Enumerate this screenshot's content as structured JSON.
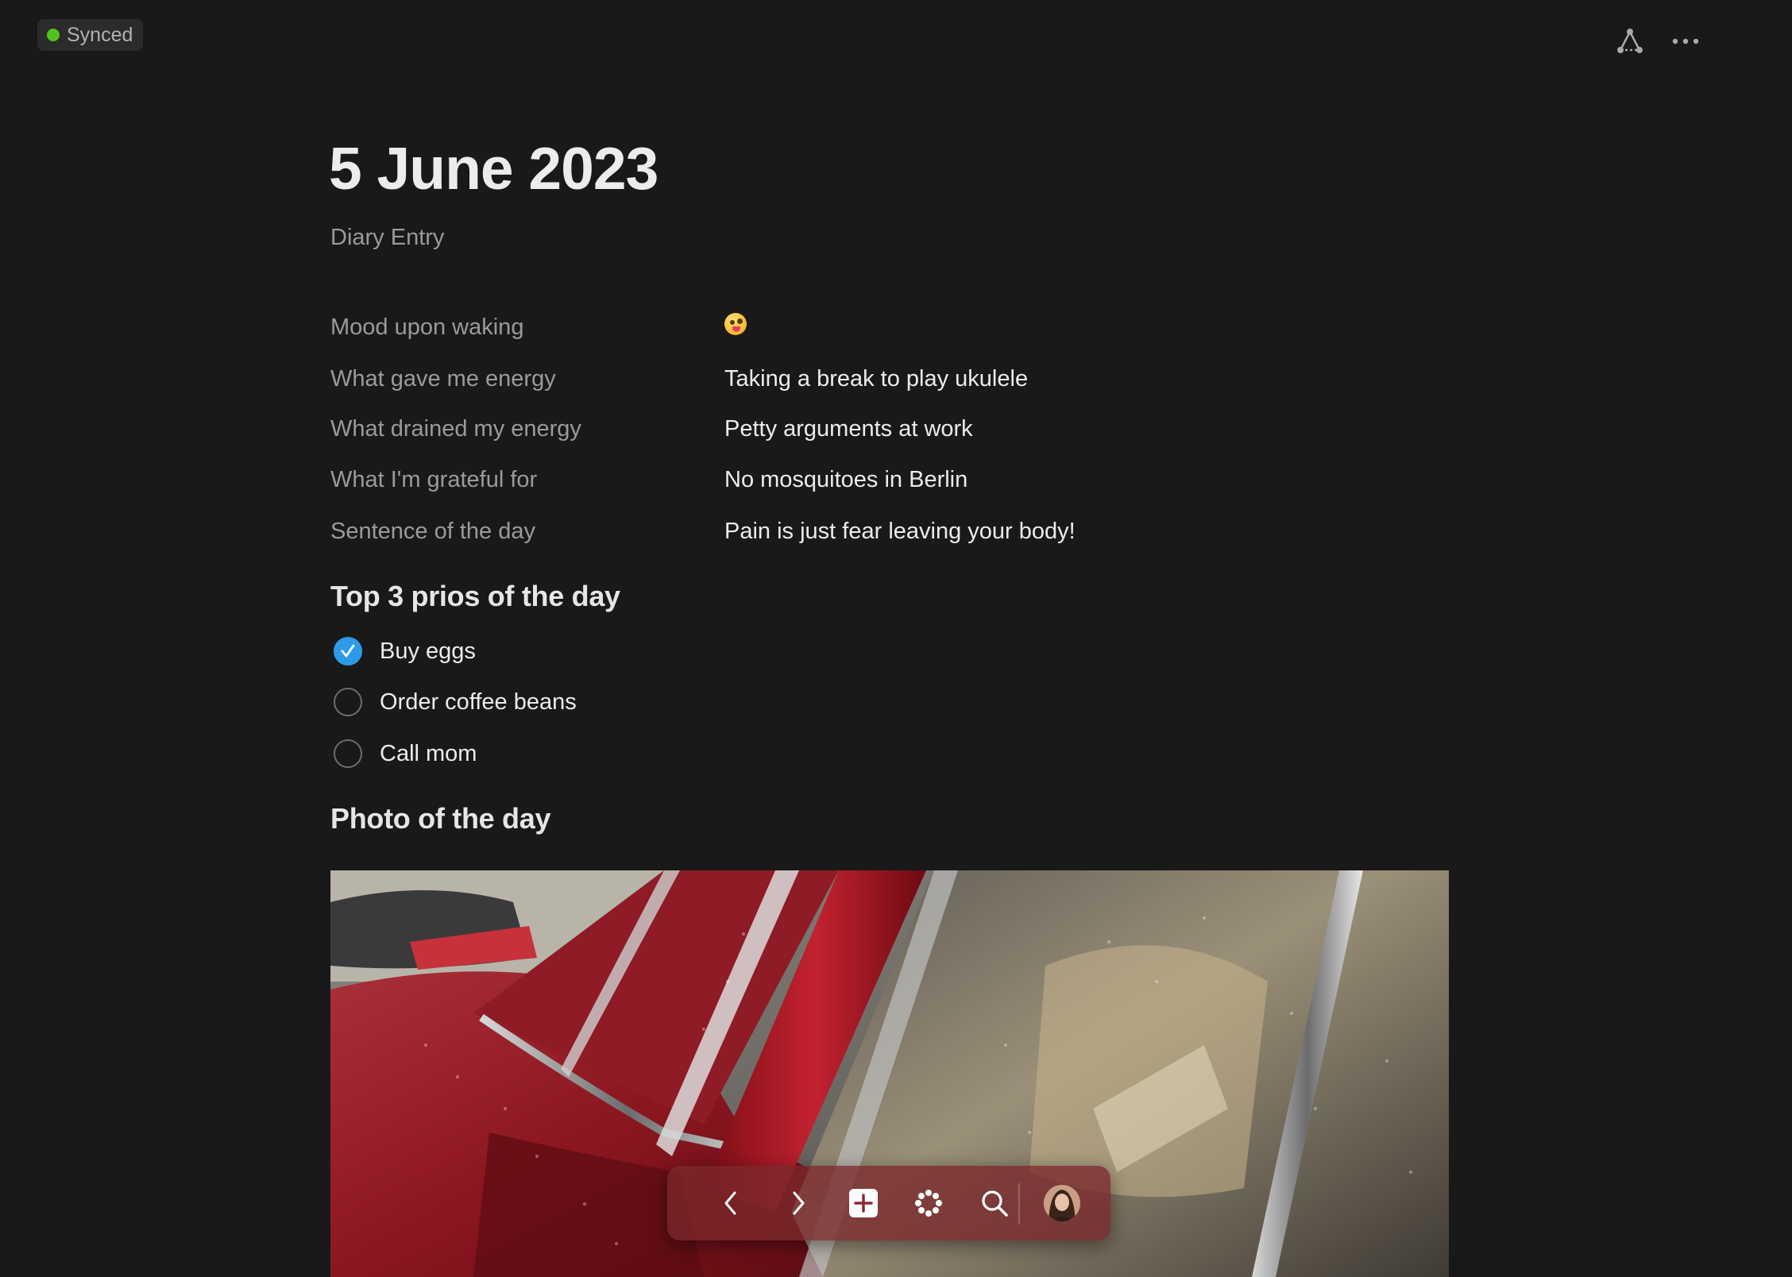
{
  "status": {
    "label": "Synced",
    "color": "#4fc41b"
  },
  "top_actions": {
    "graph_icon": "graph-icon",
    "more_icon": "more-horizontal-icon"
  },
  "page": {
    "title": "5 June 2023",
    "subtitle": "Diary Entry"
  },
  "properties": [
    {
      "label": "Mood upon waking",
      "value": "",
      "emoji": "zany-face-emoji"
    },
    {
      "label": "What gave me energy",
      "value": "Taking a break to play ukulele"
    },
    {
      "label": "What drained my energy",
      "value": "Petty arguments at work"
    },
    {
      "label": "What I'm grateful for",
      "value": "No mosquitoes in Berlin"
    },
    {
      "label": "Sentence of the day",
      "value": "Pain is just fear leaving your body!"
    }
  ],
  "priorities": {
    "heading": "Top 3 prios of the day",
    "items": [
      {
        "label": "Buy eggs",
        "checked": true
      },
      {
        "label": "Order coffee beans",
        "checked": false
      },
      {
        "label": "Call mom",
        "checked": false
      }
    ]
  },
  "photo_section": {
    "heading": "Photo of the day",
    "image": "red-vintage-car-with-raindrops-photo"
  },
  "toolbar": {
    "back_icon": "chevron-left-icon",
    "forward_icon": "chevron-right-icon",
    "new_icon": "plus-square-icon",
    "apps_icon": "dots-flower-icon",
    "search_icon": "search-icon",
    "avatar": "user-avatar"
  },
  "colors": {
    "background": "#191919",
    "accent_check": "#2e9be8",
    "muted_text": "#9b9b9b"
  }
}
